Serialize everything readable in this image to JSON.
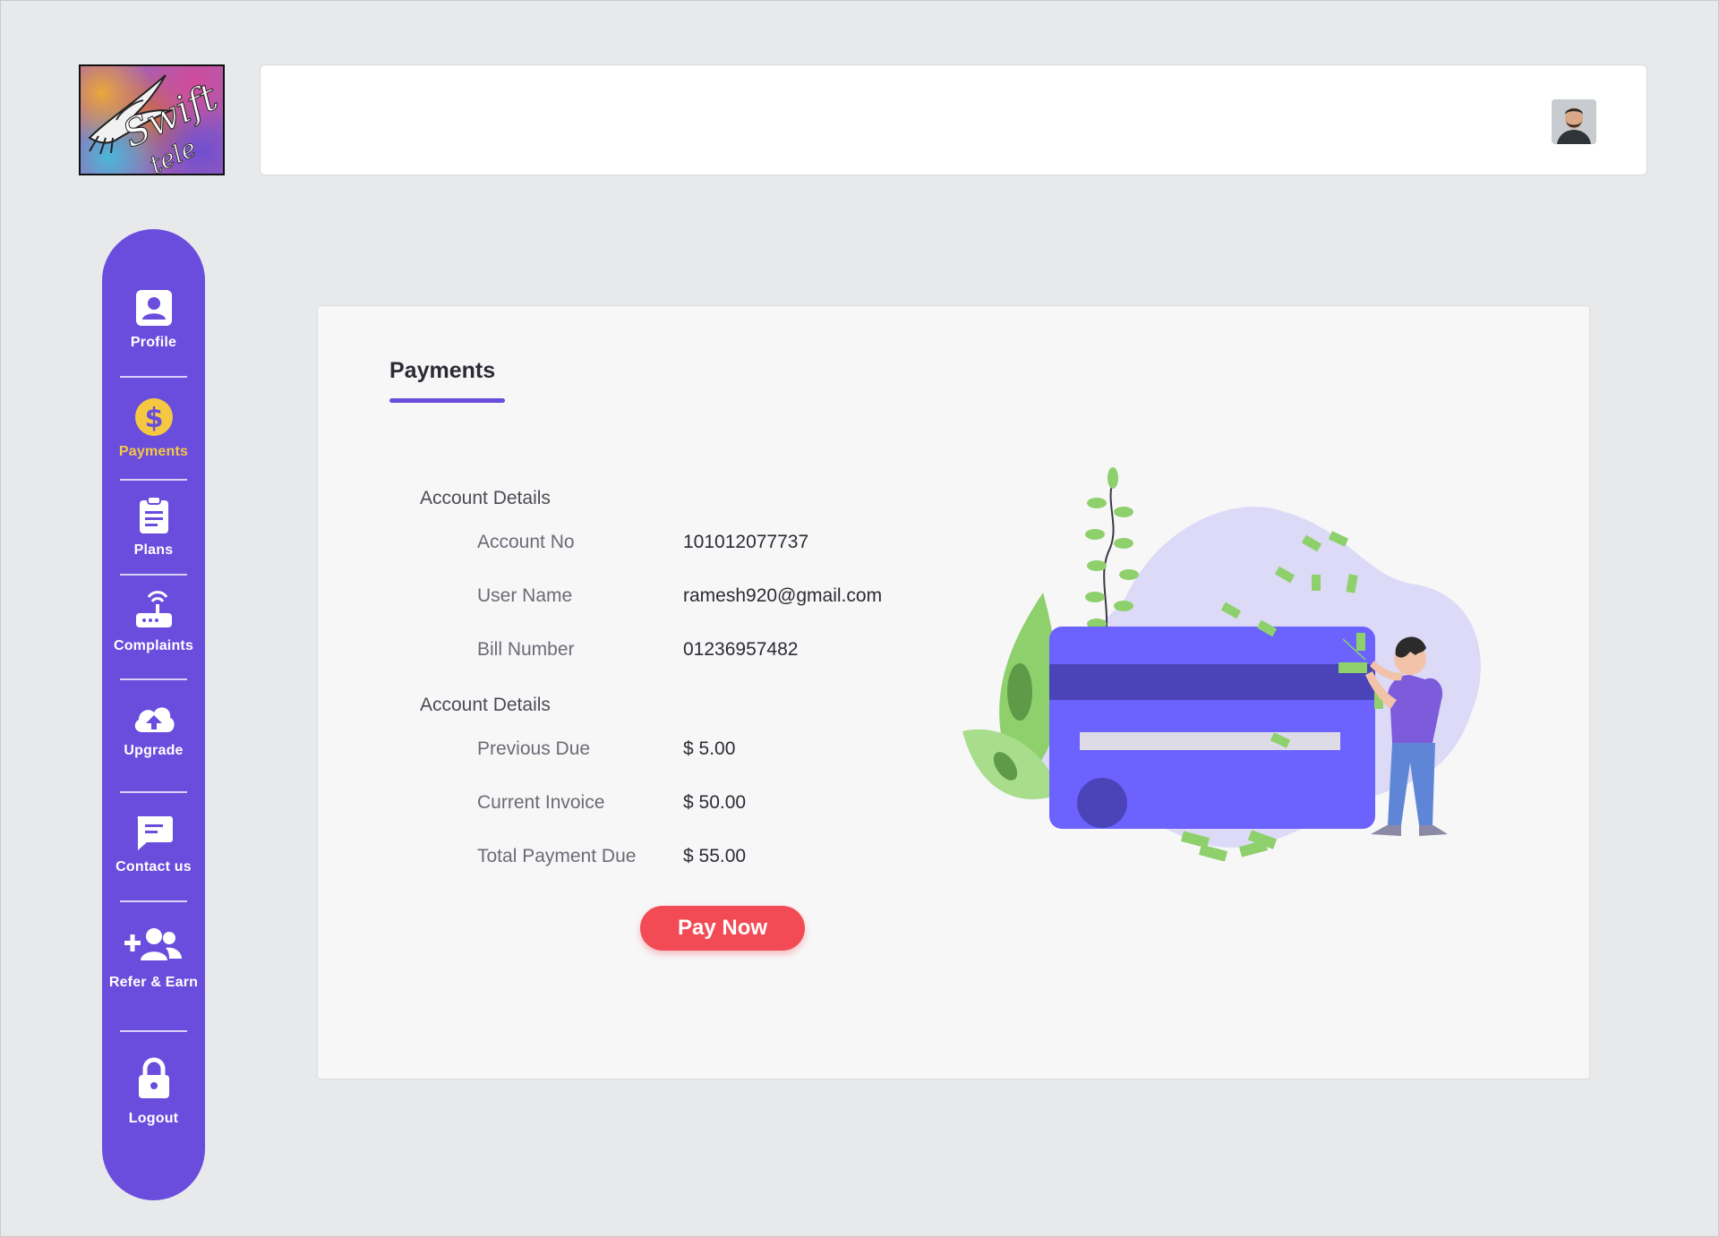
{
  "app": {
    "logo_text_line1": "Swift",
    "logo_text_line2": "tele"
  },
  "sidebar": {
    "items": [
      {
        "label": "Profile",
        "icon": "profile-icon",
        "active": false
      },
      {
        "label": "Payments",
        "icon": "dollar-icon",
        "active": true
      },
      {
        "label": "Plans",
        "icon": "clipboard-icon",
        "active": false
      },
      {
        "label": "Complaints",
        "icon": "router-icon",
        "active": false
      },
      {
        "label": "Upgrade",
        "icon": "cloud-upload-icon",
        "active": false
      },
      {
        "label": "Contact us",
        "icon": "message-icon",
        "active": false
      },
      {
        "label": "Refer & Earn",
        "icon": "user-plus-icon",
        "active": false
      },
      {
        "label": "Logout",
        "icon": "lock-icon",
        "active": false
      }
    ]
  },
  "main": {
    "tab_title": "Payments",
    "account_section": {
      "title": "Account Details",
      "rows": [
        {
          "label": "Account No",
          "value": "101012077737"
        },
        {
          "label": "User Name",
          "value": "ramesh920@gmail.com"
        },
        {
          "label": "Bill Number",
          "value": "01236957482"
        }
      ]
    },
    "billing_section": {
      "title": "Account Details",
      "rows": [
        {
          "label": "Previous Due",
          "value": "$ 5.00"
        },
        {
          "label": "Current Invoice",
          "value": "$ 50.00"
        },
        {
          "label": "Total Payment Due",
          "value": "$ 55.00"
        }
      ]
    },
    "pay_button_label": "Pay Now"
  },
  "colors": {
    "accent": "#6a4ddd",
    "active_nav": "#f5c842",
    "pay_button": "#f24b55",
    "background": "#e8e9eb"
  }
}
